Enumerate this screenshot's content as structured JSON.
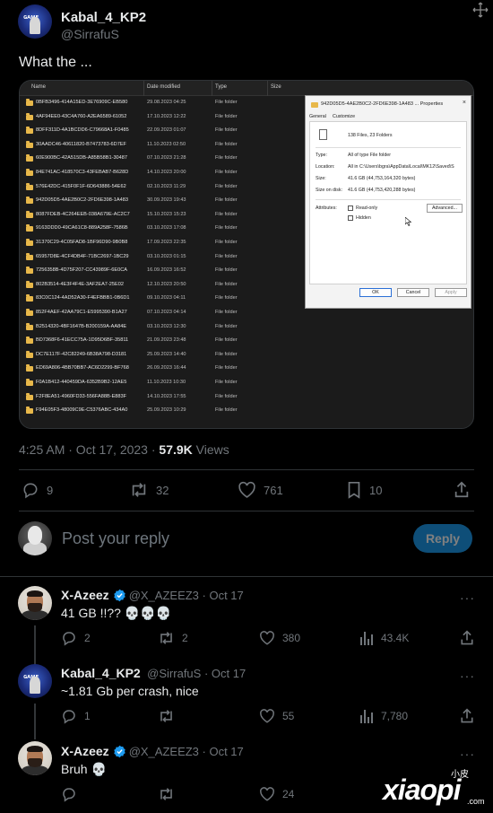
{
  "tweet": {
    "author_name": "Kabal_4_KP2",
    "author_handle": "@SirrafuS",
    "text": "What the ...",
    "time": "4:25 AM · Oct 17, 2023 ·",
    "views_count": "57.9K",
    "views_label": "Views",
    "stats": {
      "replies": "9",
      "reposts": "32",
      "likes": "761",
      "bookmarks": "10"
    }
  },
  "screenshot": {
    "headers": [
      "Name",
      "Date modified",
      "Type",
      "Size"
    ],
    "rows": [
      {
        "name": "0BFB3496-414A15ED-3E76909C-EB580",
        "date": "29.08.2023 04:25",
        "type": "File folder"
      },
      {
        "name": "4AF94EE0-43C4A760-A2EA6589-61052",
        "date": "17.10.2023 12:22",
        "type": "File folder"
      },
      {
        "name": "8DFF311D-4A1BCDD6-C79668A1-F0485",
        "date": "22.09.2023 01:07",
        "type": "File folder"
      },
      {
        "name": "30AADC46-40611820-B7473783-6D7EF",
        "date": "11.10.2023 02:50",
        "type": "File folder"
      },
      {
        "name": "60E900BC-42A515DB-A85B58B1-30487",
        "date": "07.10.2023 21:28",
        "type": "File folder"
      },
      {
        "name": "84E741AC-418570C3-43FEBAB7-B628D",
        "date": "14.10.2023 20:00",
        "type": "File folder"
      },
      {
        "name": "576E42DC-415F0F1F-6D643886-54E62",
        "date": "02.10.2023 11:29",
        "type": "File folder"
      },
      {
        "name": "942D05D5-4AE2B0C2-2FD6E398-1A483",
        "date": "30.09.2023 19:43",
        "type": "File folder"
      },
      {
        "name": "8087FDEB-4C264EEB-038A679E-AC2C7",
        "date": "15.10.2023 15:23",
        "type": "File folder"
      },
      {
        "name": "9163DDD0-49CA61C8-889A258F-7586B",
        "date": "03.10.2023 17:08",
        "type": "File folder"
      },
      {
        "name": "31370C29-4C05FAD8-1BF96D90-9B0B8",
        "date": "17.09.2023 22:35",
        "type": "File folder"
      },
      {
        "name": "65957D8E-4CF4DB4F-71BC2697-1BC29",
        "date": "03.10.2023 01:15",
        "type": "File folder"
      },
      {
        "name": "7256358B-4D75F207-CC43989F-6E0CA",
        "date": "16.09.2023 16:52",
        "type": "File folder"
      },
      {
        "name": "802B3514-4E3F4F4E-3AF2EA7-25E02",
        "date": "12.10.2023 20:50",
        "type": "File folder"
      },
      {
        "name": "83C0C124-4AD52A30-F4EFBBB1-0B6D1",
        "date": "09.10.2023 04:11",
        "type": "File folder"
      },
      {
        "name": "852F4AEF-42AA79C1-E5995390-B1A27",
        "date": "07.10.2023 04:14",
        "type": "File folder"
      },
      {
        "name": "B2514320-4BF1647B-B200159A-AA84E",
        "date": "03.10.2023 12:30",
        "type": "File folder"
      },
      {
        "name": "BD7368F6-41ECC75A-1D95D6BF-35811",
        "date": "21.09.2023 23:48",
        "type": "File folder"
      },
      {
        "name": "DC7E117F-42C82249-6B38A798-D3181",
        "date": "25.09.2023 14:40",
        "type": "File folder"
      },
      {
        "name": "ED69A806-4BB70BB7-AC6D2299-BF768",
        "date": "26.09.2023 16:44",
        "type": "File folder"
      },
      {
        "name": "F0A1B412-440459DA-6352B9B2-12AE5",
        "date": "11.10.2023 10:30",
        "type": "File folder"
      },
      {
        "name": "F2F8EA51-4960FD33-556FA88B-E883F",
        "date": "14.10.2023 17:55",
        "type": "File folder"
      },
      {
        "name": "F94E05F3-48009C9E-C5376ABC-434A0",
        "date": "25.09.2023 10:29",
        "type": "File folder"
      }
    ],
    "dialog": {
      "title": "942D05D5-4AE2B0C2-2FD6E398-1A483 ... Properties",
      "close": "×",
      "tab_general": "General",
      "tab_customize": "Customize",
      "contains": "138 Files, 23 Folders",
      "type_label": "Type:",
      "type_value": "All of type File folder",
      "location_label": "Location:",
      "location_value": "All in C:\\Users\\bgra\\AppData\\Local\\MK12\\Saved\\S",
      "size_label": "Size:",
      "size_value": "41.6 GB (44,753,164,320 bytes)",
      "size_disk_label": "Size on disk:",
      "size_disk_value": "41.6 GB (44,753,420,288 bytes)",
      "attributes_label": "Attributes:",
      "readonly_label": "Read-only",
      "hidden_label": "Hidden",
      "advanced_label": "Advanced...",
      "ok_label": "OK",
      "cancel_label": "Cancel",
      "apply_label": "Apply"
    }
  },
  "compose": {
    "placeholder": "Post your reply",
    "button": "Reply"
  },
  "replies": [
    {
      "name": "X-Azeez",
      "handle": "@X_AZEEZ3 · Oct 17",
      "text": "41 GB !!?? 💀💀💀",
      "comments": "2",
      "reposts": "2",
      "likes": "380",
      "views": "43.4K"
    },
    {
      "name": "Kabal_4_KP2",
      "handle": "@SirrafuS · Oct 17",
      "text": "~1.81 Gb per crash, nice",
      "comments": "1",
      "reposts": "",
      "likes": "55",
      "views": "7,780"
    },
    {
      "name": "X-Azeez",
      "handle": "@X_AZEEZ3 · Oct 17",
      "text": "Bruh 💀",
      "comments": "",
      "reposts": "",
      "likes": "24",
      "views": ""
    }
  ],
  "watermark": {
    "small": "小皮",
    "big": "xiaopi",
    "suffix": ".com"
  },
  "colors": {
    "accent": "#1d9bf0",
    "verified": "#1d9bf0",
    "muted": "#71767b",
    "text": "#e7e9ea",
    "folder": "#e8b84a"
  }
}
